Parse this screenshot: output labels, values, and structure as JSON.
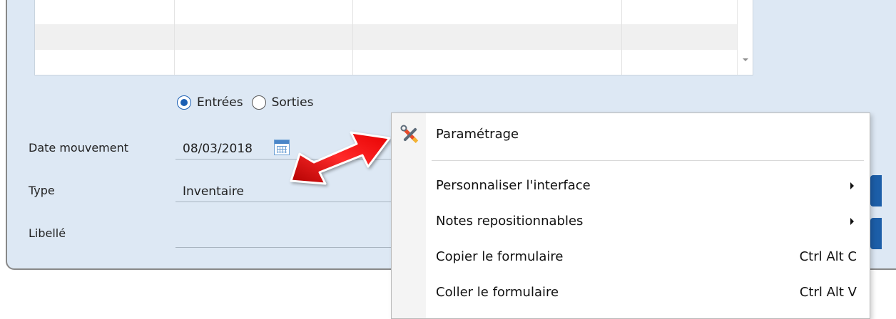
{
  "grid": {
    "rows": 3
  },
  "radio": {
    "options": [
      {
        "label": "Entrées",
        "checked": true
      },
      {
        "label": "Sorties",
        "checked": false
      }
    ]
  },
  "form": {
    "date": {
      "label": "Date mouvement",
      "value": "08/03/2018"
    },
    "type": {
      "label": "Type",
      "value": "Inventaire"
    },
    "libelle": {
      "label": "Libellé",
      "value": ""
    }
  },
  "context_menu": {
    "items": [
      {
        "label": "Paramétrage",
        "icon": "tools-icon"
      },
      {
        "label": "Personnaliser l'interface",
        "submenu": true
      },
      {
        "label": "Notes repositionnables",
        "submenu": true
      },
      {
        "label": "Copier le formulaire",
        "shortcut": "Ctrl Alt C"
      },
      {
        "label": "Coller le formulaire",
        "shortcut": "Ctrl Alt V"
      }
    ]
  },
  "colors": {
    "window_bg": "#dde8f4",
    "accent": "#1a5fb4",
    "arrow": "#e11b1b"
  }
}
